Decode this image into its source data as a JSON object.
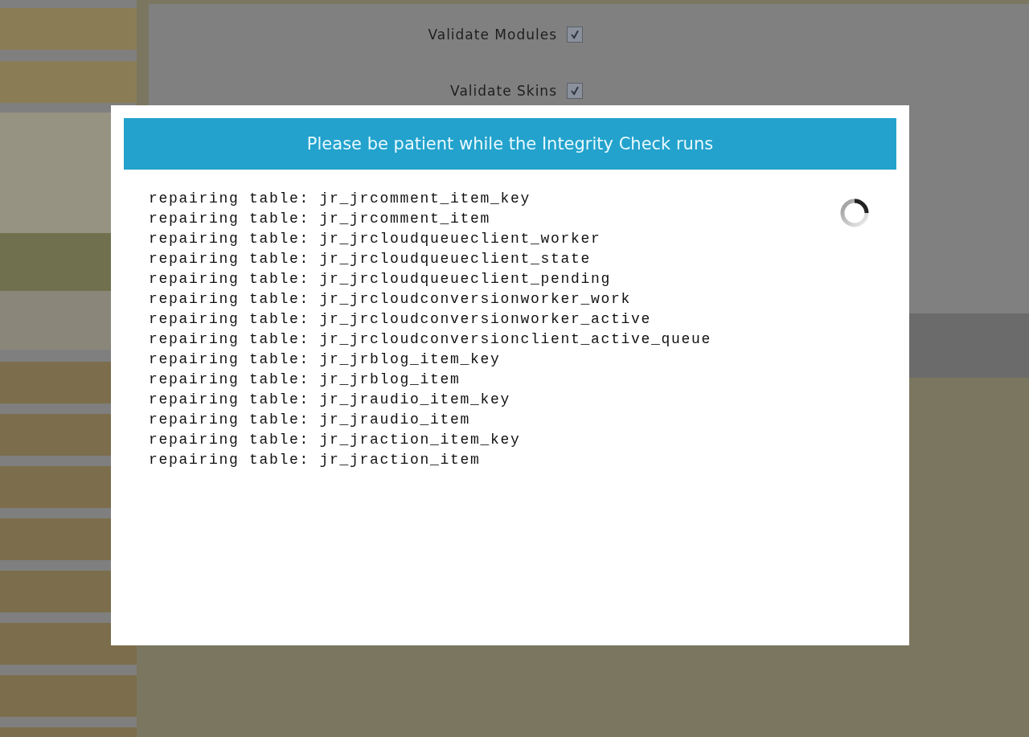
{
  "form": {
    "fields": [
      {
        "label": "Validate Modules",
        "checked": true
      },
      {
        "label": "Validate Skins",
        "checked": true
      }
    ]
  },
  "dialog": {
    "title": "Please be patient while the Integrity Check runs",
    "log": [
      "repairing table: jr_jrcomment_item_key",
      "repairing table: jr_jrcomment_item",
      "repairing table: jr_jrcloudqueueclient_worker",
      "repairing table: jr_jrcloudqueueclient_state",
      "repairing table: jr_jrcloudqueueclient_pending",
      "repairing table: jr_jrcloudconversionworker_work",
      "repairing table: jr_jrcloudconversionworker_active",
      "repairing table: jr_jrcloudconversionclient_active_queue",
      "repairing table: jr_jrblog_item_key",
      "repairing table: jr_jrblog_item",
      "repairing table: jr_jraudio_item_key",
      "repairing table: jr_jraudio_item",
      "repairing table: jr_jraction_item_key",
      "repairing table: jr_jraction_item"
    ]
  }
}
